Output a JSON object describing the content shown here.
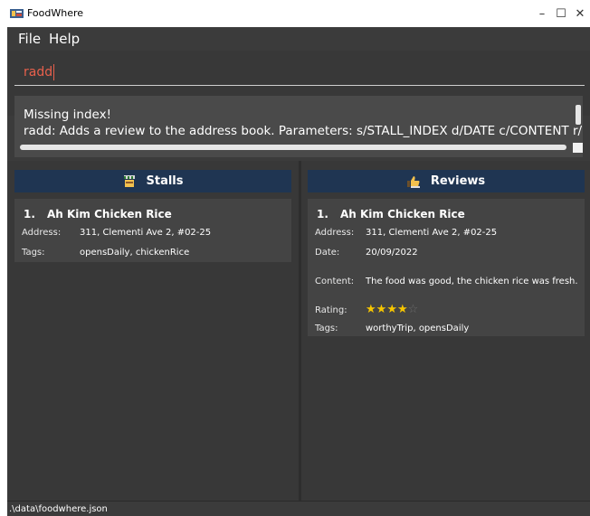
{
  "window": {
    "title": "FoodWhere",
    "minimize_glyph": "–",
    "maximize_glyph": "☐",
    "close_glyph": "✕"
  },
  "menu": {
    "items": [
      {
        "label": "File"
      },
      {
        "label": "Help"
      }
    ]
  },
  "command_box": {
    "value": "radd"
  },
  "result_display": {
    "lines": [
      "Missing index!",
      "radd: Adds a review to the address book. Parameters: s/STALL_INDEX d/DATE c/CONTENT r/RATING [t/TAG]..."
    ]
  },
  "stalls_panel": {
    "title": "Stalls",
    "icon": "stall-icon",
    "items": [
      {
        "index": "1.",
        "name": "Ah Kim Chicken Rice",
        "address_label": "Address:",
        "address": "311, Clementi Ave 2, #02-25",
        "tags_label": "Tags:",
        "tags": "opensDaily, chickenRice"
      }
    ]
  },
  "reviews_panel": {
    "title": "Reviews",
    "icon": "thumbs-up-icon",
    "items": [
      {
        "index": "1.",
        "name": "Ah Kim Chicken Rice",
        "address_label": "Address:",
        "address": "311, Clementi Ave 2, #02-25",
        "date_label": "Date:",
        "date": "20/09/2022",
        "content_label": "Content:",
        "content": "The food was good, the chicken rice was fresh.",
        "rating_label": "Rating:",
        "rating": 4,
        "rating_max": 5,
        "tags_label": "Tags:",
        "tags": "worthyTrip, opensDaily"
      }
    ]
  },
  "status_bar": {
    "path": ".\\data\\foodwhere.json"
  },
  "colors": {
    "background": "#3b3b3b",
    "header_blue": "#1f3552",
    "card": "#444444",
    "command_text": "#e8604c",
    "star": "#f7c600"
  }
}
